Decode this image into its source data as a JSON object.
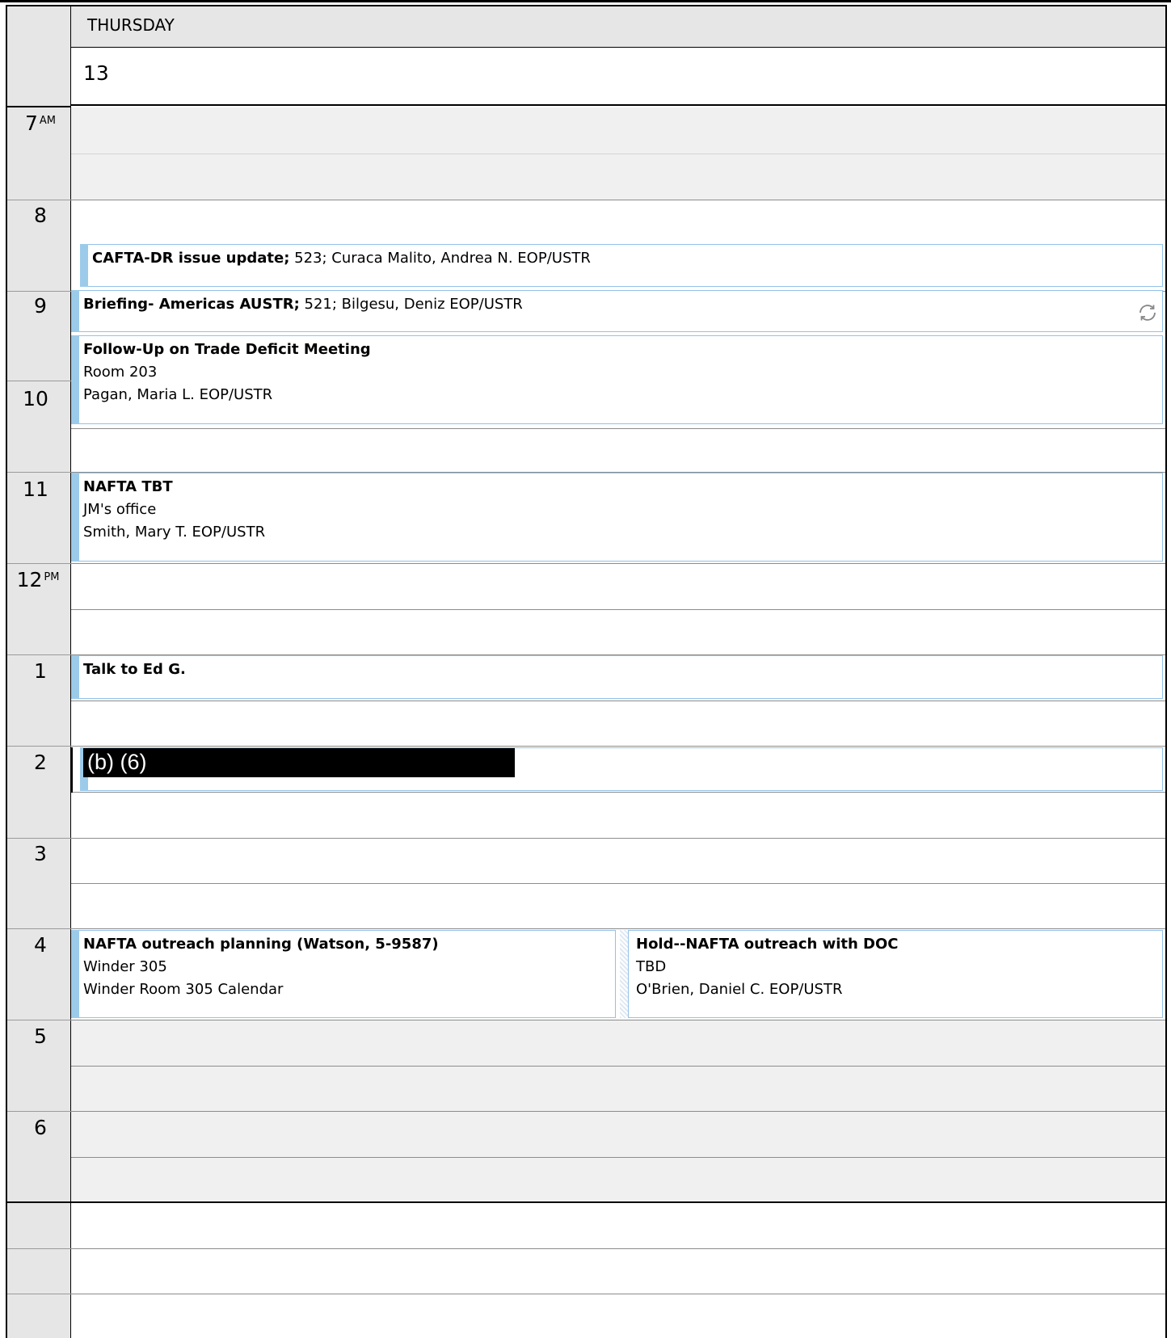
{
  "day_header": {
    "weekday": "THURSDAY",
    "date": "13"
  },
  "hours": [
    {
      "label": "7",
      "suffix": "AM"
    },
    {
      "label": "8",
      "suffix": ""
    },
    {
      "label": "9",
      "suffix": ""
    },
    {
      "label": "10",
      "suffix": ""
    },
    {
      "label": "11",
      "suffix": ""
    },
    {
      "label": "12",
      "suffix": "PM"
    },
    {
      "label": "1",
      "suffix": ""
    },
    {
      "label": "2",
      "suffix": ""
    },
    {
      "label": "3",
      "suffix": ""
    },
    {
      "label": "4",
      "suffix": ""
    },
    {
      "label": "5",
      "suffix": ""
    },
    {
      "label": "6",
      "suffix": ""
    }
  ],
  "events": {
    "cafta": {
      "title": "CAFTA-DR issue update;",
      "detail": " 523; Curaca Malito, Andrea N. EOP/USTR"
    },
    "briefing": {
      "title": "Briefing- Americas AUSTR;",
      "detail": " 521; Bilgesu, Deniz EOP/USTR",
      "icon": "sync-icon"
    },
    "followup": {
      "title": "Follow-Up on Trade Deficit Meeting",
      "location": "Room 203",
      "organizer": "Pagan, Maria L. EOP/USTR"
    },
    "nafta_tbt": {
      "title": "NAFTA TBT",
      "location": "JM's office",
      "organizer": "Smith, Mary T. EOP/USTR"
    },
    "talk_ed": {
      "title": "Talk to Ed G."
    },
    "redacted": {
      "text": "(b) (6)"
    },
    "outreach_planning": {
      "title": "NAFTA outreach planning (Watson, 5-9587)",
      "location": "Winder 305",
      "organizer": "Winder Room 305 Calendar"
    },
    "hold_outreach": {
      "title": "Hold--NAFTA outreach with DOC",
      "location": "TBD",
      "organizer": "O'Brien, Daniel C. EOP/USTR"
    }
  },
  "colors": {
    "event_border": "#93c2e8",
    "event_bar": "#9ccbea",
    "offhours_bg": "#f0f0f0",
    "gutter_bg": "#e6e6e6"
  }
}
